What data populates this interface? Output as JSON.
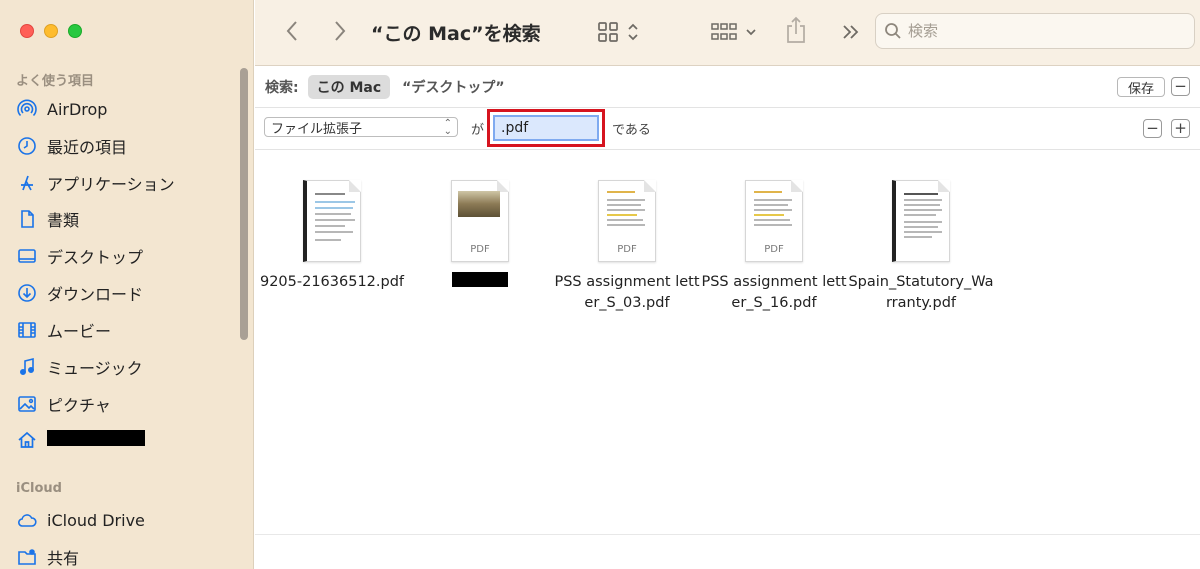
{
  "window": {
    "title": "“この Mac”を検索"
  },
  "sidebar": {
    "favorites_heading": "よく使う項目",
    "items": [
      {
        "label": "AirDrop",
        "icon": "airdrop-icon"
      },
      {
        "label": "最近の項目",
        "icon": "clock-icon"
      },
      {
        "label": "アプリケーション",
        "icon": "applications-icon"
      },
      {
        "label": "書類",
        "icon": "document-icon"
      },
      {
        "label": "デスクトップ",
        "icon": "desktop-icon"
      },
      {
        "label": "ダウンロード",
        "icon": "download-icon"
      },
      {
        "label": "ムービー",
        "icon": "movie-icon"
      },
      {
        "label": "ミュージック",
        "icon": "music-icon"
      },
      {
        "label": "ピクチャ",
        "icon": "picture-icon"
      },
      {
        "label": "",
        "icon": "home-icon"
      }
    ],
    "icloud_heading": "iCloud",
    "icloud_items": [
      {
        "label": "iCloud Drive",
        "icon": "cloud-icon"
      },
      {
        "label": "共有",
        "icon": "shared-folder-icon"
      }
    ]
  },
  "search": {
    "placeholder": "検索"
  },
  "scope": {
    "label": "検索:",
    "selected": "この Mac",
    "alternative": "“デスクトップ”",
    "save_label": "保存"
  },
  "criteria": {
    "attribute": "ファイル拡張子",
    "conjunction": "が",
    "value": ".pdf",
    "suffix": "である"
  },
  "files": [
    {
      "name": "9205-21636512.pdf"
    },
    {
      "name": "",
      "tag": "PDF"
    },
    {
      "name": "PSS assignment letter_S_03.pdf",
      "tag": "PDF"
    },
    {
      "name": "PSS assignment letter_S_16.pdf",
      "tag": "PDF"
    },
    {
      "name": "Spain_Statutory_Warranty.pdf"
    }
  ],
  "colors": {
    "accent": "#1a73e8",
    "highlight_border": "#d6141f",
    "sidebar_bg": "#f3e6d1"
  }
}
